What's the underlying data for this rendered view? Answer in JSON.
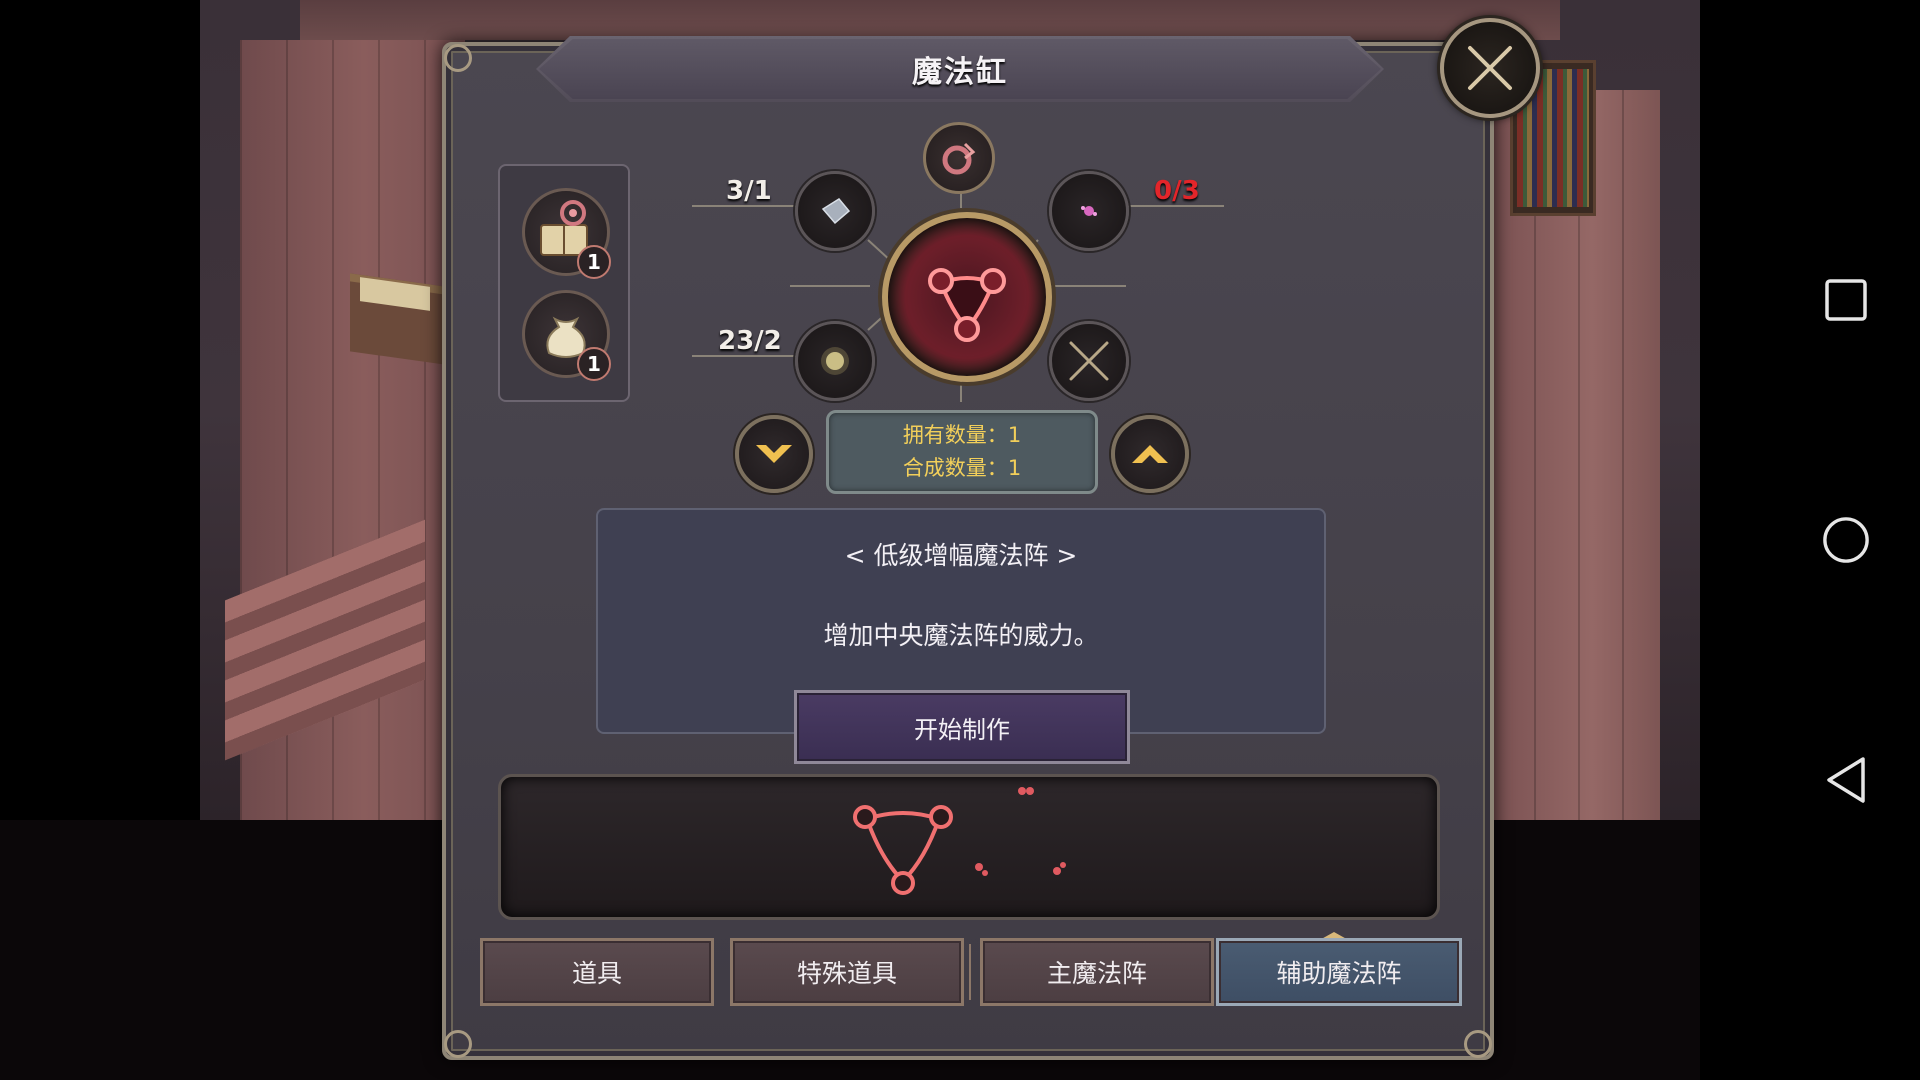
{
  "dialog": {
    "title": "魔法缸",
    "close_icon": "close-x-icon"
  },
  "inventory": {
    "items": [
      {
        "icon": "spellbook-icon",
        "count": "1"
      },
      {
        "icon": "pouch-icon",
        "count": "1"
      }
    ]
  },
  "recipe": {
    "top_icon": "amplify-circle-icon",
    "center_icon": "magic-circle-icon",
    "ingredients": [
      {
        "icon": "crystal-shard-icon",
        "ratio": "3/1",
        "insufficient": false
      },
      {
        "icon": "pink-dust-icon",
        "ratio": "0/3",
        "insufficient": true
      },
      {
        "icon": "gold-dust-icon",
        "ratio": "23/2",
        "insufficient": false
      },
      {
        "icon": "empty-slot-x-icon",
        "ratio": "",
        "insufficient": false
      }
    ],
    "owned_label": "拥有数量：",
    "owned_value": "1",
    "craft_label": "合成数量：",
    "craft_value": "1",
    "decrease_icon": "chevron-down-icon",
    "increase_icon": "chevron-up-icon"
  },
  "description": {
    "title": "< 低级增幅魔法阵 >",
    "text": "增加中央魔法阵的威力。",
    "start_button": "开始制作"
  },
  "tabs": [
    {
      "label": "道具",
      "active": false
    },
    {
      "label": "特殊道具",
      "active": false
    },
    {
      "label": "主魔法阵",
      "active": false
    },
    {
      "label": "辅助魔法阵",
      "active": true
    }
  ],
  "navbar": {
    "icons": [
      "recent-apps-icon",
      "home-icon",
      "back-icon"
    ]
  },
  "colors": {
    "accent_gold": "#f2cf5a",
    "insufficient_red": "#e3252a",
    "magic_pink": "#f07070",
    "active_tab": "#4a5c72"
  }
}
